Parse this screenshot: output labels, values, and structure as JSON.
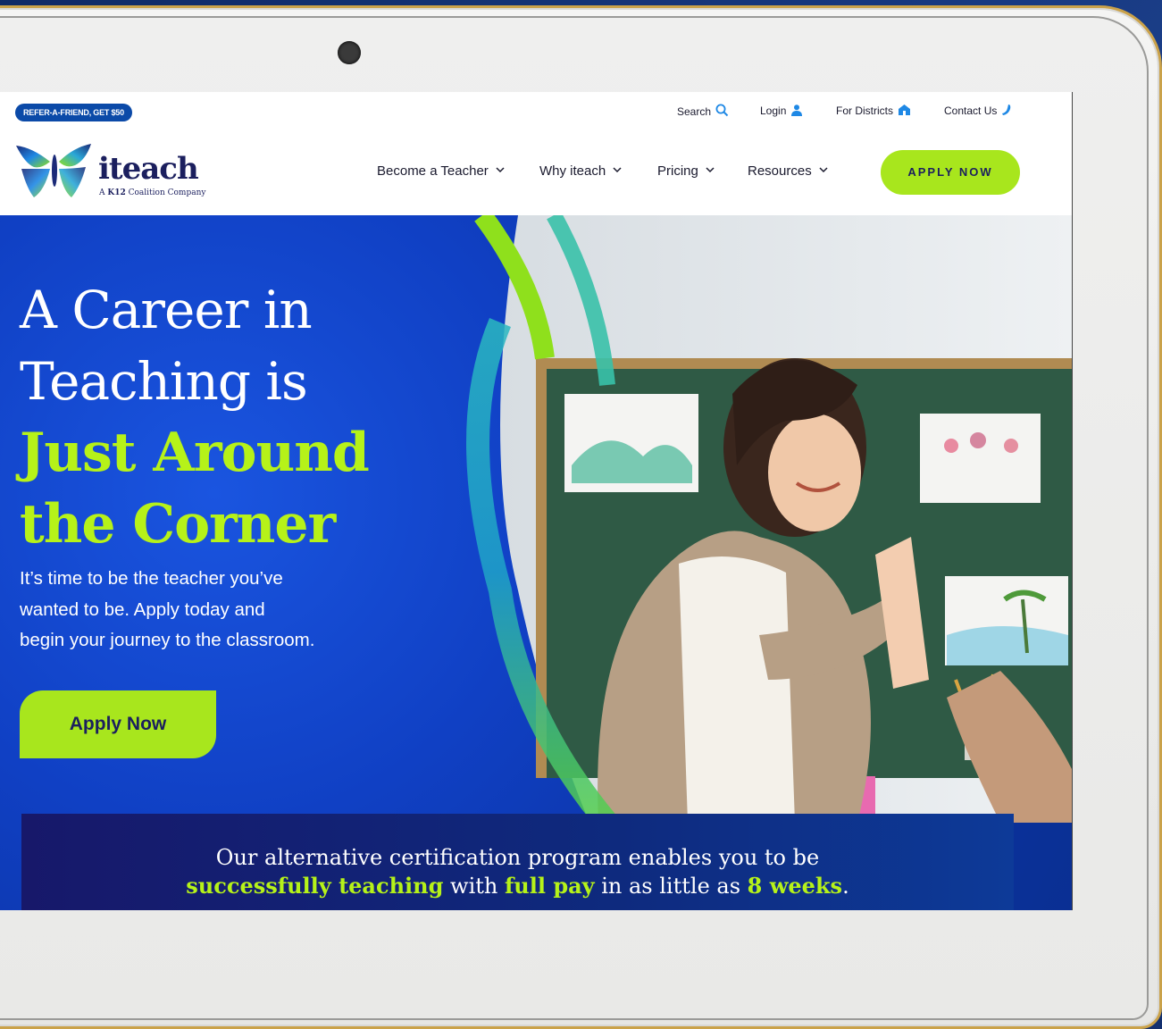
{
  "utilbar": {
    "refer": "REFER-A-FRIEND, GET $50",
    "search": "Search",
    "login": "Login",
    "districts": "For Districts",
    "contact": "Contact Us"
  },
  "logo": {
    "word": "iteach",
    "sub_prefix": "A",
    "sub_brand": "K12",
    "sub_suffix": "Coalition Company"
  },
  "nav": {
    "items": [
      {
        "label": "Become a Teacher"
      },
      {
        "label": "Why iteach"
      },
      {
        "label": "Pricing"
      },
      {
        "label": "Resources"
      }
    ],
    "apply": "APPLY NOW"
  },
  "hero": {
    "title_line1": "A Career in",
    "title_line2": "Teaching is",
    "title_line3": "Just Around",
    "title_line4": "the Corner",
    "sub_line1": "It’s time to be the teacher you’ve",
    "sub_line2": "wanted to be. Apply today and",
    "sub_line3": "begin your journey to the classroom.",
    "apply": "Apply Now"
  },
  "banner": {
    "line1": "Our alternative certification program enables you to be",
    "p1": "successfully teaching",
    "p2": " with ",
    "p3": "full pay",
    "p4": " in as little as ",
    "p5": "8 weeks",
    "p6": "."
  },
  "colors": {
    "accent_green": "#a8e61d",
    "brand_navy": "#1b1f5e",
    "hero_blue": "#1040c4",
    "link_blue": "#1e88e5"
  },
  "icons": [
    "camera-dot",
    "search-icon",
    "user-icon",
    "building-icon",
    "phone-icon",
    "chevron-down-icon",
    "butterfly-logo"
  ]
}
